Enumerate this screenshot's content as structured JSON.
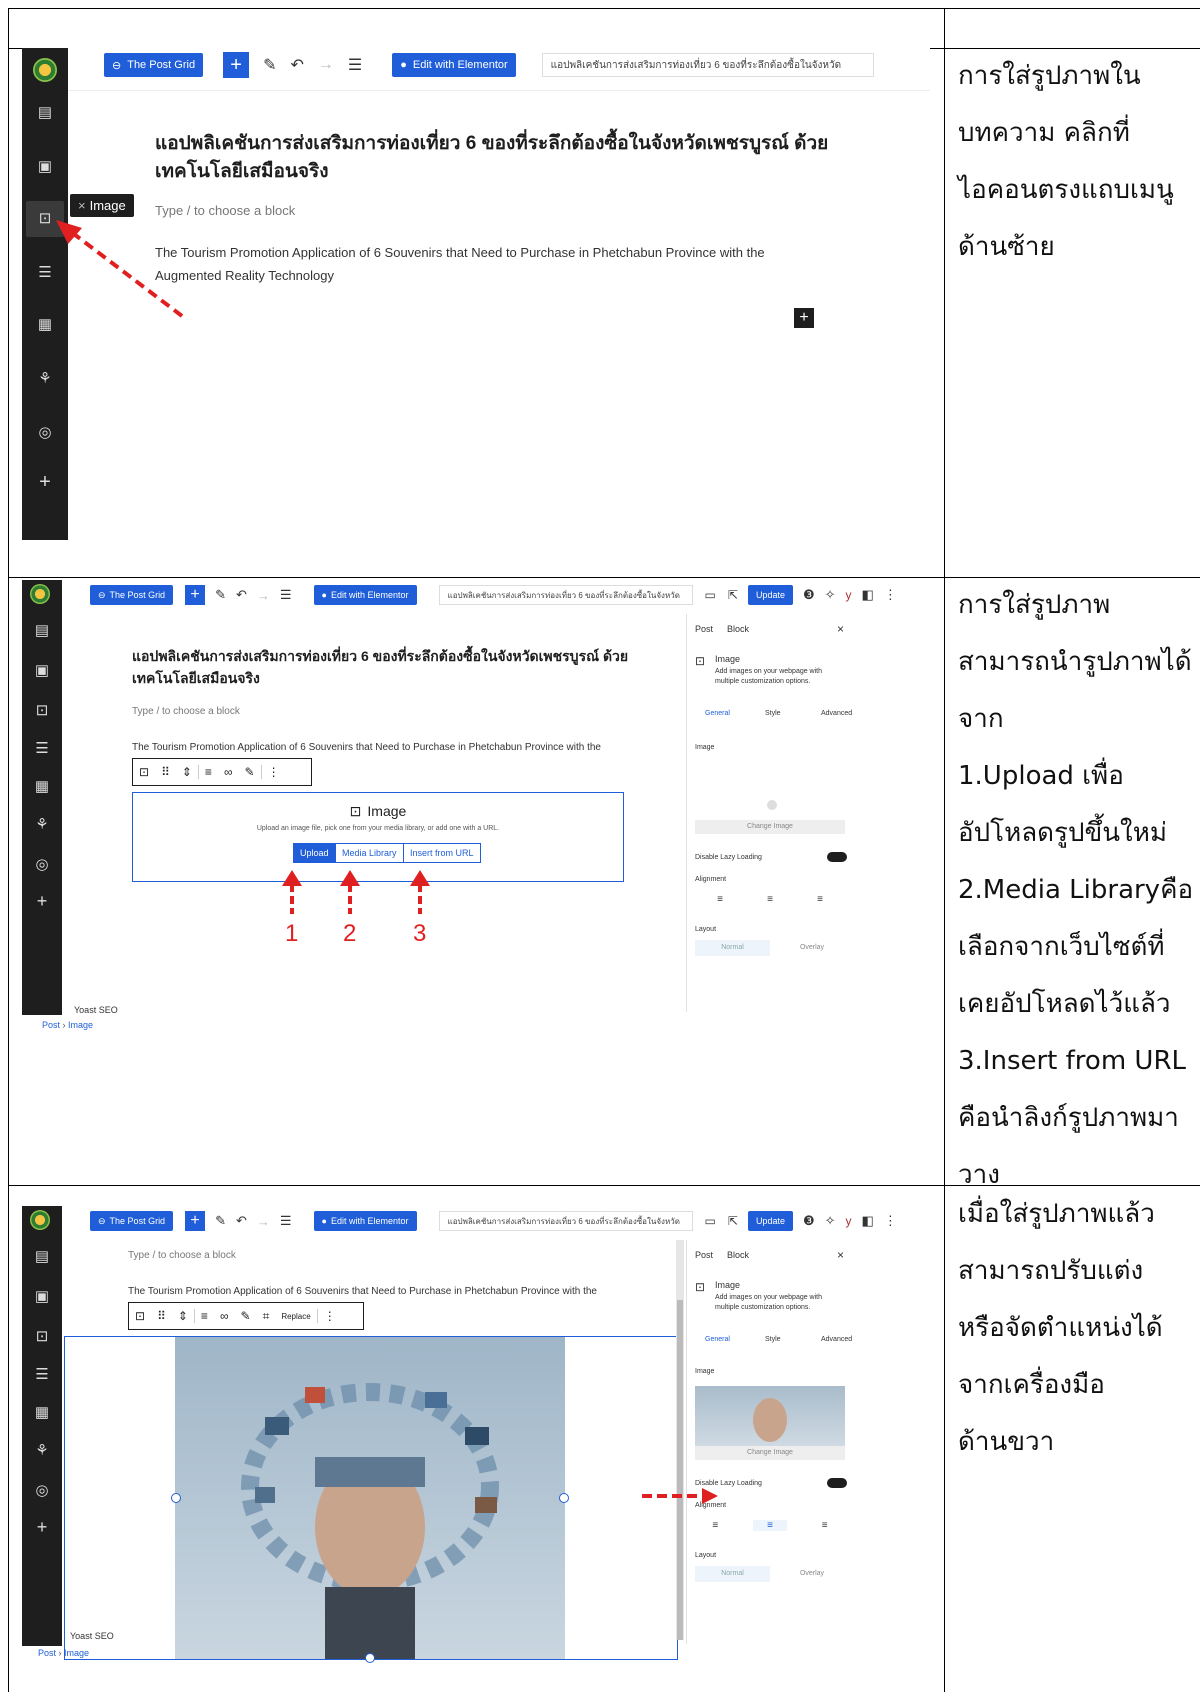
{
  "rows": [
    {
      "note_lines": [
        "การใส่รูปภาพใน",
        "บทความ คลิกที่",
        "ไอคอนตรงแถบเมนู",
        "ด้านซ้าย"
      ],
      "toolbar": {
        "post_grid": "The Post Grid",
        "elementor": "Edit with Elementor",
        "doc_title": "แอปพลิเคชันการส่งเสริมการท่องเที่ยว 6 ของที่ระลึกต้องซื้อในจังหวัด"
      },
      "title_line1": "แอปพลิเคชันการส่งเสริมการท่องเที่ยว 6 ของที่ระลึกต้องซื้อในจังหวัดเพชรบูรณ์ ด้วย",
      "title_line2": "เทคโนโลยีเสมือนจริง",
      "placeholder": "Type / to choose a block",
      "body_line1": "The Tourism Promotion Application of 6 Souvenirs that Need to Purchase in Phetchabun Province with the",
      "body_line2": "Augmented Reality Technology",
      "tooltip": "Image"
    },
    {
      "note_lines": [
        "การใส่รูปภาพ",
        "สามารถนำรูปภาพได้",
        "จาก",
        "1.Upload เพื่อ",
        "อัปโหลดรูปขึ้นใหม่",
        "2.Media Libraryคือ",
        "เลือกจากเว็บไซต์ที่",
        "เคยอัปโหลดไว้แล้ว",
        "3.Insert from URL",
        "คือนำลิงก์รูปภาพมา",
        "วาง"
      ],
      "toolbar": {
        "post_grid": "The Post Grid",
        "elementor": "Edit with Elementor",
        "doc_title": "แอปพลิเคชันการส่งเสริมการท่องเที่ยว 6 ของที่ระลึกต้องซื้อในจังหวัด",
        "update": "Update"
      },
      "title_line1": "แอปพลิเคชันการส่งเสริมการท่องเที่ยว 6 ของที่ระลึกต้องซื้อในจังหวัดเพชรบูรณ์ ด้วย",
      "title_line2": "เทคโนโลยีเสมือนจริง",
      "placeholder": "Type / to choose a block",
      "body_line1": "The Tourism Promotion Application of 6 Souvenirs that Need to Purchase in Phetchabun Province with the",
      "image_block": {
        "heading": "Image",
        "desc": "Upload an image file, pick one from your media library, or add one with a URL.",
        "upload": "Upload",
        "media": "Media Library",
        "url": "Insert from URL"
      },
      "numbers": [
        "1",
        "2",
        "3"
      ],
      "inspector": {
        "tab_post": "Post",
        "tab_block": "Block",
        "block_name": "Image",
        "block_desc1": "Add images on your webpage with",
        "block_desc2": "multiple customization options.",
        "general": "General",
        "style": "Style",
        "advanced": "Advanced",
        "section": "Image",
        "change": "Change Image",
        "lazy": "Disable Lazy Loading",
        "alignment": "Alignment",
        "layout": "Layout",
        "normal": "Normal",
        "overlay": "Overlay"
      },
      "yoast": "Yoast SEO",
      "crumb_post": "Post",
      "crumb_image": "Image"
    },
    {
      "note_lines": [
        "เมื่อใส่รูปภาพแล้ว",
        "สามารถปรับแต่ง",
        "หรือจัดตำแหน่งได้",
        "จากเครื่องมือ",
        "ด้านขวา"
      ],
      "toolbar": {
        "post_grid": "The Post Grid",
        "elementor": "Edit with Elementor",
        "doc_title": "แอปพลิเคชันการส่งเสริมการท่องเที่ยว 6 ของที่ระลึกต้องซื้อในจังหวัด",
        "update": "Update"
      },
      "placeholder": "Type / to choose a block",
      "body_line1": "The Tourism Promotion Application of 6 Souvenirs that Need to Purchase in Phetchabun Province with the",
      "replace": "Replace",
      "inspector": {
        "tab_post": "Post",
        "tab_block": "Block",
        "block_name": "Image",
        "block_desc1": "Add images on your webpage with",
        "block_desc2": "multiple customization options.",
        "general": "General",
        "style": "Style",
        "advanced": "Advanced",
        "section": "Image",
        "change": "Change Image",
        "lazy": "Disable Lazy Loading",
        "alignment": "Alignment",
        "layout": "Layout",
        "normal": "Normal",
        "overlay": "Overlay"
      },
      "yoast": "Yoast SEO",
      "crumb_post": "Post",
      "crumb_image": "Image"
    }
  ]
}
